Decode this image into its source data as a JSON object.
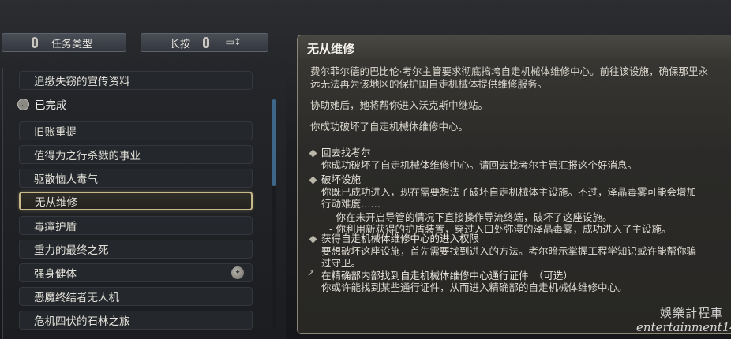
{
  "top_controls": {
    "quest_type_label": "任务类型",
    "sort_label": "长按",
    "sort_icon": "sort-arrows-icon"
  },
  "quest_list": {
    "items": [
      {
        "label": "追缴失窃的宣传资料"
      },
      {
        "label": "旧账重提"
      },
      {
        "label": "值得为之行杀戮的事业"
      },
      {
        "label": "驱散恼人毒气"
      },
      {
        "label": "无从维修",
        "selected": true
      },
      {
        "label": "毒瘴护盾"
      },
      {
        "label": "重力的最终之死"
      },
      {
        "label": "强身健体",
        "icon": "reward-icon"
      },
      {
        "label": "恶魔终结者无人机"
      },
      {
        "label": "危机四伏的石林之旅"
      }
    ],
    "group_label": "已完成"
  },
  "detail": {
    "title": "无从维修",
    "desc_line1": "费尔菲尔德的巴比伦·考尔主管要求彻底搞垮自走机械体维修中心。前往该设施，确保那里永",
    "desc_line2": "远无法再为该地区的保护国自走机械体提供维修服务。",
    "desc_line3": "协助她后，她将帮你进入沃克斯中继站。",
    "desc_line4": "你成功破坏了自走机械体维修中心。",
    "objectives": [
      {
        "title": "回去找考尔",
        "lines": [
          "你成功破坏了自走机械体维修中心。请回去找考尔主管汇报这个好消息。"
        ]
      },
      {
        "title": "破坏设施",
        "lines": [
          "你既已成功进入，现在需要想法子破坏自走机械体主设施。不过，泽晶毒雾可能会增加",
          "行动难度……"
        ],
        "subs": [
          "- 你在未开启导管的情况下直接操作导流终端，破坏了这座设施。",
          "- 你利用新获得的护盾装置，穿过入口处弥漫的泽晶毒雾，成功进入了主设施。"
        ]
      },
      {
        "title": "获得自走机械体维修中心的进入权限",
        "lines": [
          "要想破坏这座设施，首先需要找到进入的方法。考尔暗示掌握工程学知识或许能帮你骗",
          "过守卫。"
        ]
      },
      {
        "title": "在精确部内部找到自走机械体维修中心通行证件　（可选）",
        "lines": [
          "你或许能找到某些通行证件，从而进入精确部的自走机械体维修中心。"
        ]
      }
    ]
  },
  "watermark": {
    "line1": "娛樂計程車",
    "line2": "entertainment14"
  }
}
